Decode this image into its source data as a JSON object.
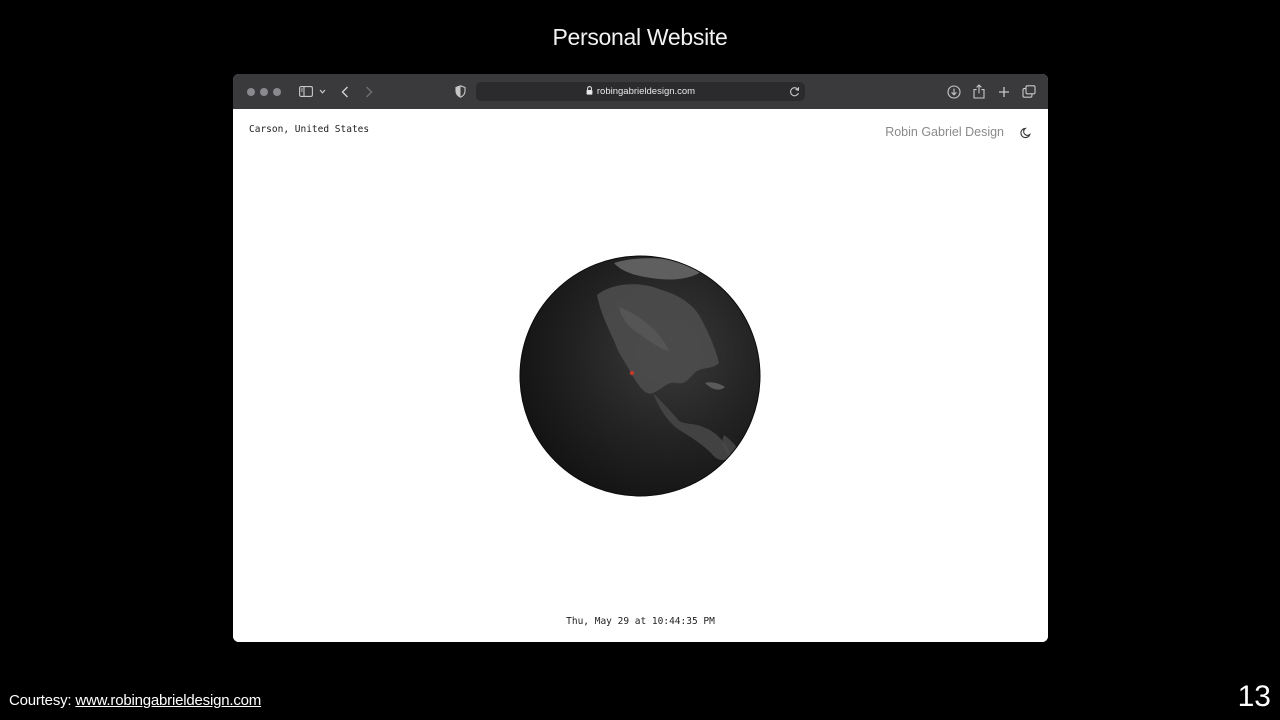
{
  "slide": {
    "title": "Personal Website",
    "courtesy_prefix": "Courtesy: ",
    "courtesy_link": "www.robingabrieldesign.com",
    "page_number": "13"
  },
  "browser": {
    "url": "robingabrieldesign.com",
    "icons": [
      "sidebar-icon",
      "chevron-down-icon",
      "back-icon",
      "forward-icon",
      "privacy-shield-icon",
      "lock-icon",
      "reload-icon",
      "download-icon",
      "share-icon",
      "new-tab-icon",
      "tab-overview-icon"
    ]
  },
  "website": {
    "location": "Carson, United States",
    "site_name": "Robin Gabriel Design",
    "theme_icon": "moon-icon",
    "datetime": "Thu, May 29 at 10:44:35 PM"
  },
  "colors": {
    "slide_background": "#000000",
    "toolbar": "#3a3a3c",
    "page_background": "#ffffff",
    "globe": "#1e1e1e",
    "marker": "#c0392b"
  }
}
